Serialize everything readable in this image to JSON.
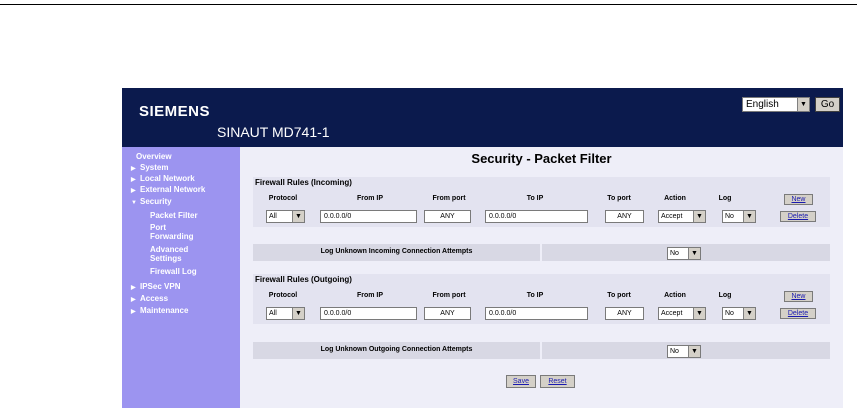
{
  "header": {
    "brand": "SIEMENS",
    "product": "SINAUT MD741-1",
    "language": "English",
    "go_label": "Go"
  },
  "sidebar": {
    "items": [
      {
        "label": "Overview",
        "arrow": ""
      },
      {
        "label": "System",
        "arrow": "▶"
      },
      {
        "label": "Local Network",
        "arrow": "▶"
      },
      {
        "label": "External Network",
        "arrow": "▶"
      },
      {
        "label": "Security",
        "arrow": "▼"
      },
      {
        "label": "Packet Filter",
        "arrow": ""
      },
      {
        "label": "Port",
        "arrow": ""
      },
      {
        "label": "Forwarding",
        "arrow": ""
      },
      {
        "label": "Advanced",
        "arrow": ""
      },
      {
        "label": "Settings",
        "arrow": ""
      },
      {
        "label": "Firewall Log",
        "arrow": ""
      },
      {
        "label": "IPSec VPN",
        "arrow": "▶"
      },
      {
        "label": "Access",
        "arrow": "▶"
      },
      {
        "label": "Maintenance",
        "arrow": "▶"
      }
    ]
  },
  "page": {
    "title": "Security - Packet Filter"
  },
  "columns": {
    "protocol": "Protocol",
    "from_ip": "From IP",
    "from_port": "From port",
    "to_ip": "To IP",
    "to_port": "To port",
    "action": "Action",
    "log": "Log"
  },
  "incoming": {
    "heading": "Firewall Rules (Incoming)",
    "rule": {
      "protocol": "All",
      "from_ip": "0.0.0.0/0",
      "from_port": "ANY",
      "to_ip": "0.0.0.0/0",
      "to_port": "ANY",
      "action": "Accept",
      "log": "No"
    },
    "new_label": "New",
    "delete_label": "Delete",
    "log_unknown_label": "Log Unknown Incoming Connection Attempts",
    "log_unknown_value": "No"
  },
  "outgoing": {
    "heading": "Firewall Rules (Outgoing)",
    "rule": {
      "protocol": "All",
      "from_ip": "0.0.0.0/0",
      "from_port": "ANY",
      "to_ip": "0.0.0.0/0",
      "to_port": "ANY",
      "action": "Accept",
      "log": "No"
    },
    "new_label": "New",
    "delete_label": "Delete",
    "log_unknown_label": "Log Unknown Outgoing Connection Attempts",
    "log_unknown_value": "No"
  },
  "footer": {
    "save_label": "Save",
    "reset_label": "Reset"
  },
  "colors": {
    "header_bg": "#0b1a4d",
    "sidebar_bg": "#9c94f0",
    "content_bg": "#eeeef8"
  }
}
